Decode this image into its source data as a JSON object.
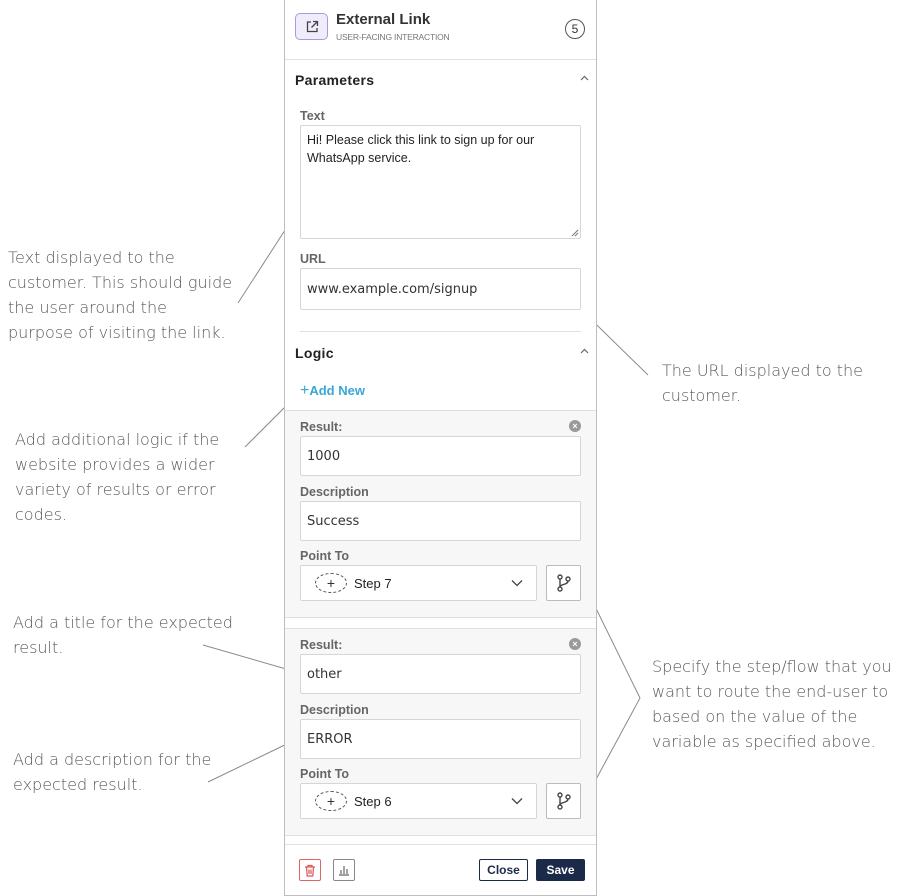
{
  "annotations": {
    "text_desc": "Text displayed to the\ncustomer. This should guide\nthe user around the\npurpose of visiting the link.",
    "url_desc": "The URL displayed to the\ncustomer.",
    "logic_desc": "Add additional logic if the\nwebsite provides a wider\nvariety of results or error\ncodes.",
    "title_desc": "Add a title for the expected\nresult.",
    "description_desc": "Add a description for the\nexpected result.",
    "route_desc": "Specify the step/flow that you\nwant to route the end-user to\nbased on the value of the\nvariable as specified above."
  },
  "header": {
    "title": "External Link",
    "subtitle": "USER-FACING INTERACTION",
    "step_number": "5",
    "icon": "external-link-icon"
  },
  "parameters": {
    "section_title": "Parameters",
    "text_label": "Text",
    "text_value": "Hi! Please click this link to sign up for our WhatsApp service.",
    "url_label": "URL",
    "url_value": "www.example.com/signup"
  },
  "logic": {
    "section_title": "Logic",
    "add_new": "Add New",
    "add_new_plus": "+",
    "results": [
      {
        "result_label": "Result:",
        "result_value": "1000",
        "description_label": "Description",
        "description_value": "Success",
        "point_to_label": "Point To",
        "point_to_value": "Step 7",
        "plus": "+"
      },
      {
        "result_label": "Result:",
        "result_value": "other",
        "description_label": "Description",
        "description_value": "ERROR",
        "point_to_label": "Point To",
        "point_to_value": "Step 6",
        "plus": "+"
      }
    ]
  },
  "footer": {
    "close_label": "Close",
    "save_label": "Save"
  },
  "colors": {
    "accent": "#3aa6d6",
    "primary_button": "#1c2a4a",
    "icon_bg": "#f1ecfb",
    "delete": "#dd6666"
  }
}
